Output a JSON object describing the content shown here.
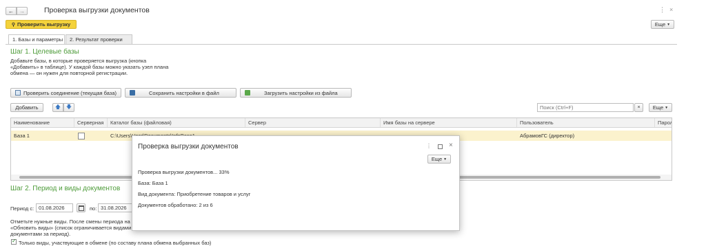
{
  "window": {
    "title": "Проверка выгрузки документов",
    "more_icon": "more-vertical-icon",
    "close_icon": "close-icon"
  },
  "toolbar": {
    "check_button": "Проверить выгрузку",
    "more_button": "Еще"
  },
  "tabs": [
    {
      "label": "1. Базы и параметры",
      "active": true
    },
    {
      "label": "2. Результат проверки",
      "active": false
    }
  ],
  "step1": {
    "title": "Шаг 1. Целевые базы",
    "desc_line1": "Добавьте базы, в которые проверяется выгрузка (кнопка",
    "desc_line2": "«Добавить» в таблице). У каждой базы можно указать узел плана",
    "desc_line3": "обмена — он нужен для повторной регистрации."
  },
  "actions": {
    "check_connection": "Проверить соединение (текущая база)",
    "save_settings": "Сохранить настройки в файл",
    "load_settings": "Загрузить настройки из файла"
  },
  "table_toolbar": {
    "add_button": "Добавить",
    "search_placeholder": "Поиск (Ctrl+F)",
    "more_button": "Еще"
  },
  "table": {
    "columns": [
      "Наименование",
      "Серверная",
      "Каталог базы (файловая)",
      "Сервер",
      "Имя базы на сервере",
      "Пользователь",
      "Парол"
    ],
    "rows": [
      {
        "name": "База 1",
        "server_flag": false,
        "catalog": "C:\\Users\\User\\Documents\\InfoBase1",
        "server": "",
        "db_name": "",
        "user": "АбрамовГС (директор)",
        "password": ""
      }
    ]
  },
  "step2": {
    "title": "Шаг 2. Период и виды документов",
    "period_from_label": "Период с:",
    "period_from": "01.08.2026",
    "period_to_label": "по:",
    "period_to": "31.08.2026",
    "note_line1": "Отметьте нужные виды. После смены периода на",
    "note_line2": "«Обновить виды» (список ограничивается видами",
    "note_line3": "документами за период).",
    "checkbox_label": "Только виды, участвующие в обмене (по составу плана обмена выбранных баз)",
    "checkbox_checked": true
  },
  "dialog": {
    "title": "Проверка выгрузки документов",
    "more_button": "Еще",
    "progress_text": "Проверка выгрузки документов... 33%",
    "progress_percent": 33,
    "base_line": "База: База 1",
    "doc_type_line": "Вид документа: Приобретение товаров и услуг",
    "processed_line": "Документов обработано: 2 из 6"
  },
  "colors": {
    "accent_yellow": "#f4d23b",
    "green_text": "#4d9b39",
    "selected_row": "#fbf2cd"
  }
}
